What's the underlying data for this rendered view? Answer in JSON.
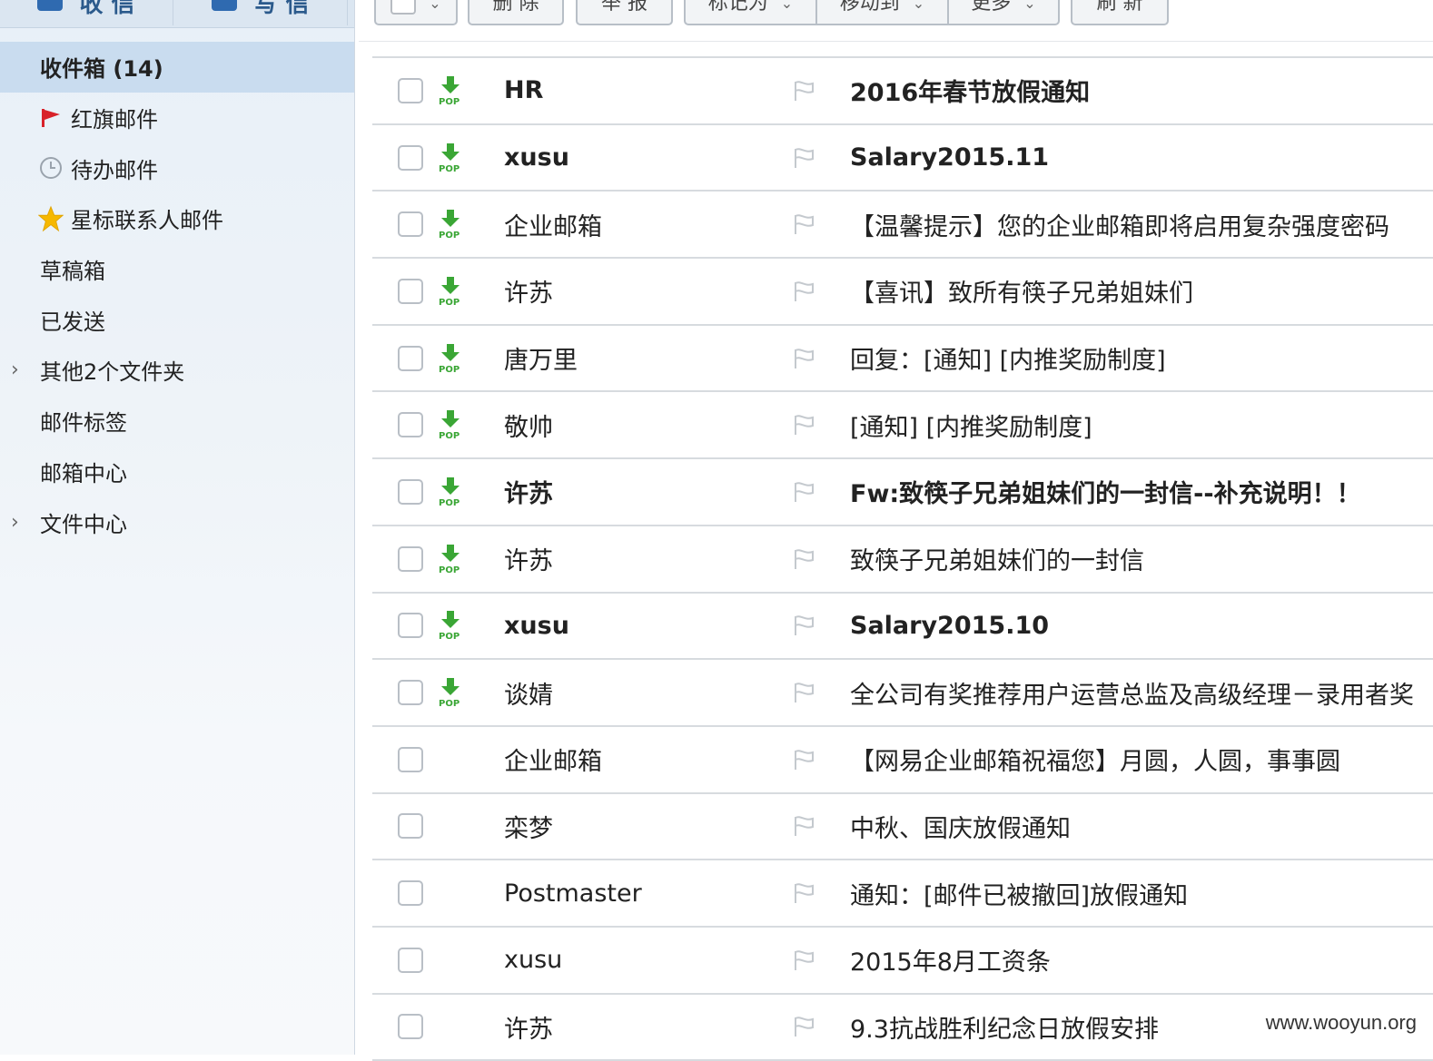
{
  "sidebar": {
    "top_buttons": [
      {
        "label": "收 信"
      },
      {
        "label": "写 信"
      }
    ],
    "folders": [
      {
        "label": "收件箱 (14)",
        "icon": "",
        "active": true
      },
      {
        "label": "红旗邮件",
        "icon": "red-flag-icon"
      },
      {
        "label": "待办邮件",
        "icon": "clock-icon"
      },
      {
        "label": "星标联系人邮件",
        "icon": "star-icon"
      },
      {
        "label": "草稿箱",
        "icon": ""
      },
      {
        "label": "已发送",
        "icon": ""
      },
      {
        "label": "其他2个文件夹",
        "icon": "",
        "expandable": true
      },
      {
        "label": "邮件标签",
        "icon": ""
      },
      {
        "label": "邮箱中心",
        "icon": ""
      },
      {
        "label": "文件中心",
        "icon": "",
        "expandable": true
      }
    ]
  },
  "toolbar": {
    "delete_label": "删 除",
    "report_label": "举 报",
    "mark_label": "标记为",
    "move_label": "移动到",
    "more_label": "更多",
    "refresh_label": "刷 新"
  },
  "mails": [
    {
      "sender": "HR",
      "subject": "2016年春节放假通知",
      "pop": true,
      "unread": true
    },
    {
      "sender": "xusu",
      "subject": "Salary2015.11",
      "pop": true,
      "unread": true
    },
    {
      "sender": "企业邮箱",
      "subject": "【温馨提示】您的企业邮箱即将启用复杂强度密码",
      "pop": true,
      "unread": false
    },
    {
      "sender": "许苏",
      "subject": "【喜讯】致所有筷子兄弟姐妹们",
      "pop": true,
      "unread": false
    },
    {
      "sender": "唐万里",
      "subject": "回复：[通知] [内推奖励制度]",
      "pop": true,
      "unread": false
    },
    {
      "sender": "敬帅",
      "subject": "[通知] [内推奖励制度]",
      "pop": true,
      "unread": false
    },
    {
      "sender": "许苏",
      "subject": "Fw:致筷子兄弟姐妹们的一封信--补充说明！！",
      "pop": true,
      "unread": true
    },
    {
      "sender": "许苏",
      "subject": "致筷子兄弟姐妹们的一封信",
      "pop": true,
      "unread": false
    },
    {
      "sender": "xusu",
      "subject": "Salary2015.10",
      "pop": true,
      "unread": true
    },
    {
      "sender": "谈婧",
      "subject": "全公司有奖推荐用户运营总监及高级经理－录用者奖",
      "pop": true,
      "unread": false
    },
    {
      "sender": "企业邮箱",
      "subject": "【网易企业邮箱祝福您】月圆，人圆，事事圆",
      "pop": false,
      "unread": false
    },
    {
      "sender": "栾梦",
      "subject": "中秋、国庆放假通知",
      "pop": false,
      "unread": false
    },
    {
      "sender": "Postmaster",
      "subject": "通知：[邮件已被撤回]放假通知",
      "pop": false,
      "unread": false
    },
    {
      "sender": "xusu",
      "subject": "2015年8月工资条",
      "pop": false,
      "unread": false
    },
    {
      "sender": "许苏",
      "subject": "9.3抗战胜利纪念日放假安排",
      "pop": false,
      "unread": false
    }
  ],
  "pop_badge": "POP",
  "watermark": "www.wooyun.org",
  "colors": {
    "active_folder_bg": "#c9dcef",
    "pop_green": "#3aa635",
    "red_flag": "#d8222a",
    "star": "#f6b800"
  }
}
